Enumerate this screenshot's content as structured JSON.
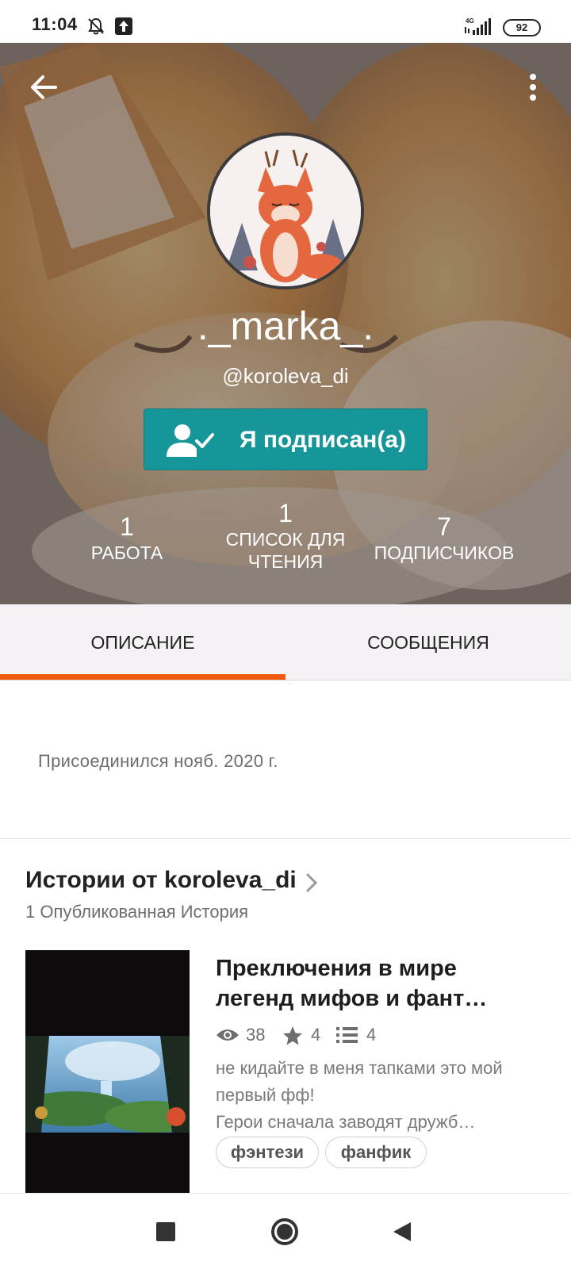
{
  "status_bar": {
    "time": "11:04",
    "network": "4G",
    "battery": "92",
    "icons": [
      "bell-off-icon",
      "upload-notification-icon",
      "signal-icon",
      "battery-icon"
    ]
  },
  "profile": {
    "display_name": "._marka_.",
    "username": "@koroleva_di",
    "follow_button": "Я подписан(а)",
    "stats": [
      {
        "value": "1",
        "label": "РАБОТА"
      },
      {
        "value": "1",
        "label": "СПИСОК ДЛЯ ЧТЕНИЯ"
      },
      {
        "value": "7",
        "label": "ПОДПИСЧИКОВ"
      }
    ]
  },
  "tabs": [
    {
      "label": "ОПИСАНИЕ",
      "active": true
    },
    {
      "label": "СООБЩЕНИЯ",
      "active": false
    }
  ],
  "about": {
    "joined": "Присоединился нояб. 2020 г."
  },
  "stories": {
    "title": "Истории от koroleva_di",
    "count": "1 Опубликованная История",
    "items": [
      {
        "title": "Преключения в мире легенд мифов и фант…",
        "reads": "38",
        "votes": "4",
        "parts": "4",
        "description_line1": "не кидайте в меня тапками это мой первый фф!",
        "description_line2": "Герои сначала заводят дружб…",
        "tags": [
          "фэнтези",
          "фанфик"
        ]
      }
    ]
  },
  "colors": {
    "accent_orange": "#f05a0e",
    "follow_teal": "#17969a"
  }
}
